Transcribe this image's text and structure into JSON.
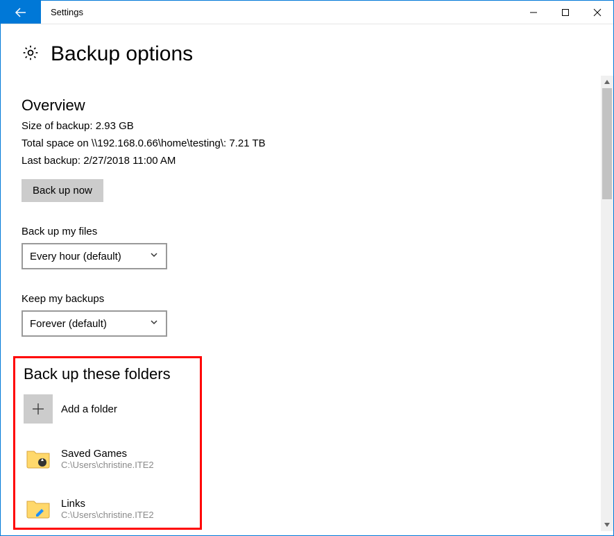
{
  "window": {
    "title": "Settings"
  },
  "page": {
    "title": "Backup options"
  },
  "overview": {
    "heading": "Overview",
    "size_line": "Size of backup: 2.93 GB",
    "total_space_line": "Total space on \\\\192.168.0.66\\home\\testing\\: 7.21 TB",
    "last_backup_line": "Last backup: 2/27/2018 11:00 AM",
    "backup_now_label": "Back up now"
  },
  "backup_frequency": {
    "label": "Back up my files",
    "value": "Every hour (default)"
  },
  "keep_backups": {
    "label": "Keep my backups",
    "value": "Forever (default)"
  },
  "folders": {
    "heading": "Back up these folders",
    "add_label": "Add a folder",
    "items": [
      {
        "name": "Saved Games",
        "path": "C:\\Users\\christine.ITE2"
      },
      {
        "name": "Links",
        "path": "C:\\Users\\christine.ITE2"
      }
    ]
  }
}
